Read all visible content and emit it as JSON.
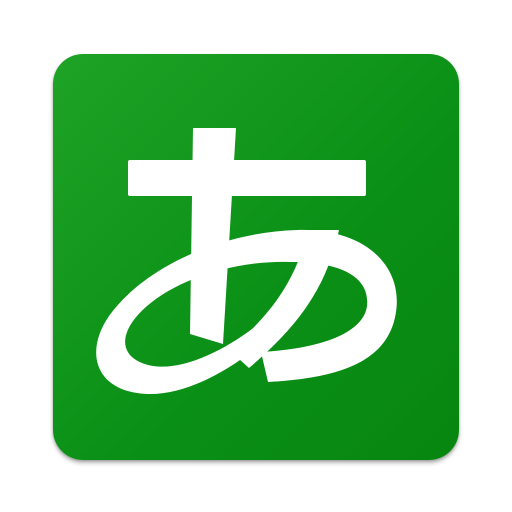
{
  "app_icon": {
    "symbol": "あ",
    "symbol_name": "hiragana-a",
    "background_color": "#0f991c",
    "glyph_color": "#ffffff"
  }
}
